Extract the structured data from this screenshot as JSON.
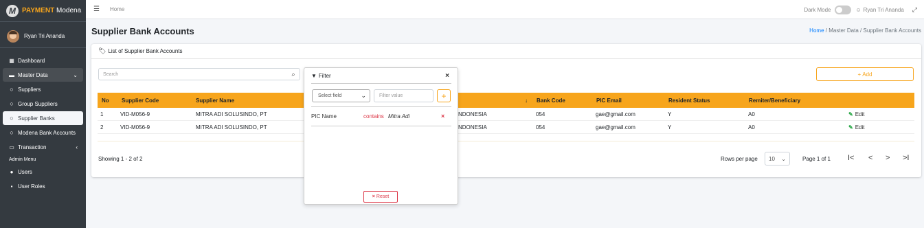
{
  "brand": {
    "accent": "PAYMENT",
    "name": "Modena",
    "logo_letter": "M"
  },
  "user": {
    "name": "Ryan Tri Ananda"
  },
  "sidebar": {
    "items": [
      {
        "label": "Dashboard",
        "icon": "grid-icon"
      },
      {
        "label": "Master Data",
        "icon": "database-icon",
        "chevron": "⌄"
      },
      {
        "label": "Suppliers",
        "icon": "circle-icon"
      },
      {
        "label": "Group Suppliers",
        "icon": "circle-icon"
      },
      {
        "label": "Supplier Banks",
        "icon": "circle-icon"
      },
      {
        "label": "Modena Bank Accounts",
        "icon": "circle-icon"
      },
      {
        "label": "Transaction",
        "icon": "card-icon",
        "chevron": "‹"
      }
    ],
    "admin_header": "Admin Menu",
    "admin_items": [
      {
        "label": "Users",
        "icon": "users-icon"
      },
      {
        "label": "User Roles",
        "icon": "lock-icon"
      }
    ]
  },
  "topbar": {
    "home": "Home",
    "dark_mode": "Dark Mode",
    "user_name": "Ryan Tri Ananda"
  },
  "page": {
    "title": "Supplier Bank Accounts",
    "breadcrumb": {
      "home": "Home",
      "sep": "/",
      "master": "Master Data",
      "current": "Supplier Bank Accounts"
    }
  },
  "card": {
    "title": "List of Supplier Bank Accounts",
    "search_placeholder": "Search",
    "add_label": "Add"
  },
  "table": {
    "columns": [
      "No",
      "Supplier Code",
      "Supplier Name",
      "Bank Code",
      "PIC Email",
      "Resident Status",
      "Remiter/Beneficiary"
    ],
    "sort_icon": "↓",
    "rows": [
      {
        "no": "1",
        "code": "VID-M056-9",
        "name": "MITRA ADI SOLUSINDO, PT",
        "country": "NDONESIA",
        "bank": "054",
        "email": "gae@gmail.com",
        "resident": "Y",
        "remiter": "A0",
        "action": "Edit"
      },
      {
        "no": "2",
        "code": "VID-M056-9",
        "name": "MITRA ADI SOLUSINDO, PT",
        "country": "NDONESIA",
        "bank": "054",
        "email": "gae@gmail.com",
        "resident": "Y",
        "remiter": "A0",
        "action": "Edit"
      }
    ]
  },
  "footer": {
    "showing": "Showing 1 - 2 of 2",
    "rows_per_page_label": "Rows per page",
    "rows_per_page_value": "10",
    "page_info": "Page 1 of 1",
    "pager": {
      "first": "I<",
      "prev": "<",
      "next": ">",
      "last": ">I"
    }
  },
  "filter": {
    "title": "Filter",
    "close": "×",
    "select_field": "Select field",
    "value_placeholder": "Filter value",
    "add": "+",
    "condition": {
      "field": "PIC Name",
      "operator": "contains",
      "value": "Mitra Adi",
      "remove": "×"
    },
    "reset_label": "Reset"
  },
  "colors": {
    "accent": "#f7a51c",
    "sidebar": "#343a40",
    "danger": "#dc3545",
    "success": "#28a745"
  }
}
